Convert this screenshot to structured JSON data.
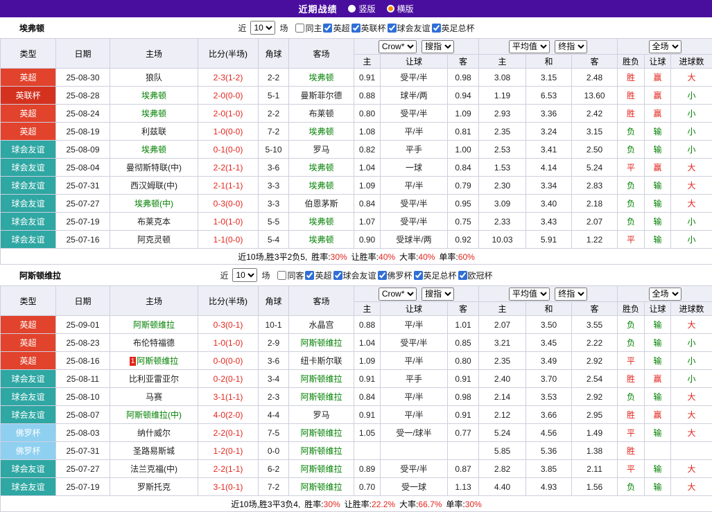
{
  "topbar": {
    "title": "近期战绩",
    "radios": [
      {
        "label": "竖版",
        "selected": false
      },
      {
        "label": "横版",
        "selected": true
      }
    ]
  },
  "colors": {
    "topbar_purple": "#4A0E9E",
    "epl_red": "#E2432C",
    "league_cup_red": "#D4321F",
    "friendly_teal": "#2FA7A3",
    "floro_blue": "#8FD0F0",
    "focus_team_green": "#008000",
    "win_red": "#E2241B",
    "loss_green": "#008000"
  },
  "sections": [
    {
      "team": "埃弗顿",
      "filter": {
        "near_label": "近",
        "games_value": "10",
        "games_label": "场",
        "checkboxes": [
          {
            "label": "同主",
            "checked": false
          },
          {
            "label": "英超",
            "checked": true
          },
          {
            "label": "英联杯",
            "checked": true
          },
          {
            "label": "球会友谊",
            "checked": true
          },
          {
            "label": "英足总杯",
            "checked": true
          }
        ]
      },
      "header": {
        "type": "类型",
        "date": "日期",
        "home": "主场",
        "score": "比分(半场)",
        "corner": "角球",
        "away": "客场",
        "odds_company": "Crow*",
        "odds_type": "搜指",
        "avg_label": "平均值",
        "final_label": "终指",
        "scope_label": "全场",
        "sub": [
          "主",
          "让球",
          "客",
          "主",
          "和",
          "客",
          "胜负",
          "让球",
          "进球数"
        ]
      },
      "rows": [
        {
          "type": "英超",
          "type_color": "red",
          "date": "25-08-30",
          "home": "狼队",
          "score": "2-3(1-2)",
          "corner": "2-2",
          "away": "埃弗顿",
          "away_focus": true,
          "o1": "0.91",
          "line": "受平/半",
          "o2": "0.98",
          "a1": "3.08",
          "a2": "3.15",
          "a3": "2.48",
          "res": "胜",
          "res_c": "red",
          "cover": "赢",
          "cover_c": "red",
          "goals": "大",
          "goals_c": "red"
        },
        {
          "type": "英联杯",
          "type_color": "darkred",
          "date": "25-08-28",
          "home": "埃弗顿",
          "home_focus": true,
          "score": "2-0(0-0)",
          "corner": "5-1",
          "away": "曼斯菲尔德",
          "o1": "0.88",
          "line": "球半/两",
          "o2": "0.94",
          "a1": "1.19",
          "a2": "6.53",
          "a3": "13.60",
          "res": "胜",
          "res_c": "red",
          "cover": "赢",
          "cover_c": "red",
          "goals": "小",
          "goals_c": "green"
        },
        {
          "type": "英超",
          "type_color": "red",
          "date": "25-08-24",
          "home": "埃弗顿",
          "home_focus": true,
          "score": "2-0(1-0)",
          "corner": "2-2",
          "away": "布莱顿",
          "o1": "0.80",
          "line": "受平/半",
          "o2": "1.09",
          "a1": "2.93",
          "a2": "3.36",
          "a3": "2.42",
          "res": "胜",
          "res_c": "red",
          "cover": "赢",
          "cover_c": "red",
          "goals": "小",
          "goals_c": "green"
        },
        {
          "type": "英超",
          "type_color": "red",
          "date": "25-08-19",
          "home": "利兹联",
          "score": "1-0(0-0)",
          "corner": "7-2",
          "away": "埃弗顿",
          "away_focus": true,
          "o1": "1.08",
          "line": "平/半",
          "o2": "0.81",
          "a1": "2.35",
          "a2": "3.24",
          "a3": "3.15",
          "res": "负",
          "res_c": "green",
          "cover": "输",
          "cover_c": "green",
          "goals": "小",
          "goals_c": "green"
        },
        {
          "type": "球会友谊",
          "type_color": "teal",
          "date": "25-08-09",
          "home": "埃弗顿",
          "home_focus": true,
          "score": "0-1(0-0)",
          "corner": "5-10",
          "away": "罗马",
          "o1": "0.82",
          "line": "平手",
          "o2": "1.00",
          "a1": "2.53",
          "a2": "3.41",
          "a3": "2.50",
          "res": "负",
          "res_c": "green",
          "cover": "输",
          "cover_c": "green",
          "goals": "小",
          "goals_c": "green"
        },
        {
          "type": "球会友谊",
          "type_color": "teal",
          "date": "25-08-04",
          "home": "曼彻斯特联(中)",
          "score": "2-2(1-1)",
          "corner": "3-6",
          "away": "埃弗顿",
          "away_focus": true,
          "o1": "1.04",
          "line": "一球",
          "o2": "0.84",
          "a1": "1.53",
          "a2": "4.14",
          "a3": "5.24",
          "res": "平",
          "res_c": "red",
          "cover": "赢",
          "cover_c": "red",
          "goals": "大",
          "goals_c": "red"
        },
        {
          "type": "球会友谊",
          "type_color": "teal",
          "date": "25-07-31",
          "home": "西汉姆联(中)",
          "score": "2-1(1-1)",
          "corner": "3-3",
          "away": "埃弗顿",
          "away_focus": true,
          "o1": "1.09",
          "line": "平/半",
          "o2": "0.79",
          "a1": "2.30",
          "a2": "3.34",
          "a3": "2.83",
          "res": "负",
          "res_c": "green",
          "cover": "输",
          "cover_c": "green",
          "goals": "大",
          "goals_c": "red"
        },
        {
          "type": "球会友谊",
          "type_color": "teal",
          "date": "25-07-27",
          "home": "埃弗顿(中)",
          "home_focus": true,
          "score": "0-3(0-0)",
          "corner": "3-3",
          "away": "伯恩茅斯",
          "o1": "0.84",
          "line": "受平/半",
          "o2": "0.95",
          "a1": "3.09",
          "a2": "3.40",
          "a3": "2.18",
          "res": "负",
          "res_c": "green",
          "cover": "输",
          "cover_c": "green",
          "goals": "大",
          "goals_c": "red"
        },
        {
          "type": "球会友谊",
          "type_color": "teal",
          "date": "25-07-19",
          "home": "布莱克本",
          "score": "1-0(1-0)",
          "corner": "5-5",
          "away": "埃弗顿",
          "away_focus": true,
          "o1": "1.07",
          "line": "受平/半",
          "o2": "0.75",
          "a1": "2.33",
          "a2": "3.43",
          "a3": "2.07",
          "res": "负",
          "res_c": "green",
          "cover": "输",
          "cover_c": "green",
          "goals": "小",
          "goals_c": "green"
        },
        {
          "type": "球会友谊",
          "type_color": "teal",
          "date": "25-07-16",
          "home": "阿克灵顿",
          "score": "1-1(0-0)",
          "corner": "5-4",
          "away": "埃弗顿",
          "away_focus": true,
          "o1": "0.90",
          "line": "受球半/两",
          "o2": "0.92",
          "a1": "10.03",
          "a2": "5.91",
          "a3": "1.22",
          "res": "平",
          "res_c": "red",
          "cover": "输",
          "cover_c": "green",
          "goals": "小",
          "goals_c": "green"
        }
      ],
      "summary": {
        "prefix": "近10场,胜3平2负5,",
        "stats": [
          {
            "label": "胜率:",
            "value": "30%"
          },
          {
            "label": "让胜率:",
            "value": "40%"
          },
          {
            "label": "大率:",
            "value": "40%"
          },
          {
            "label": "单率:",
            "value": "60%"
          }
        ]
      }
    },
    {
      "team": "阿斯顿维拉",
      "filter": {
        "near_label": "近",
        "games_value": "10",
        "games_label": "场",
        "checkboxes": [
          {
            "label": "同客",
            "checked": false
          },
          {
            "label": "英超",
            "checked": true
          },
          {
            "label": "球会友谊",
            "checked": true
          },
          {
            "label": "佛罗杯",
            "checked": true
          },
          {
            "label": "英足总杯",
            "checked": true
          },
          {
            "label": "欧冠杯",
            "checked": true
          }
        ]
      },
      "header": {
        "type": "类型",
        "date": "日期",
        "home": "主场",
        "score": "比分(半场)",
        "corner": "角球",
        "away": "客场",
        "odds_company": "Crow*",
        "odds_type": "搜指",
        "avg_label": "平均值",
        "final_label": "终指",
        "scope_label": "全场",
        "sub": [
          "主",
          "让球",
          "客",
          "主",
          "和",
          "客",
          "胜负",
          "让球",
          "进球数"
        ]
      },
      "rows": [
        {
          "type": "英超",
          "type_color": "red",
          "date": "25-09-01",
          "home": "阿斯顿维拉",
          "home_focus": true,
          "score": "0-3(0-1)",
          "corner": "10-1",
          "away": "水晶宫",
          "o1": "0.88",
          "line": "平/半",
          "o2": "1.01",
          "a1": "2.07",
          "a2": "3.50",
          "a3": "3.55",
          "res": "负",
          "res_c": "green",
          "cover": "输",
          "cover_c": "green",
          "goals": "大",
          "goals_c": "red"
        },
        {
          "type": "英超",
          "type_color": "red",
          "date": "25-08-23",
          "home": "布伦特福德",
          "score": "1-0(1-0)",
          "corner": "2-9",
          "away": "阿斯顿维拉",
          "away_focus": true,
          "o1": "1.04",
          "line": "受平/半",
          "o2": "0.85",
          "a1": "3.21",
          "a2": "3.45",
          "a3": "2.22",
          "res": "负",
          "res_c": "green",
          "cover": "输",
          "cover_c": "green",
          "goals": "小",
          "goals_c": "green"
        },
        {
          "type": "英超",
          "type_color": "red",
          "date": "25-08-16",
          "home": "阿斯顿维拉",
          "home_focus": true,
          "home_badge": "1",
          "score": "0-0(0-0)",
          "corner": "3-6",
          "away": "纽卡斯尔联",
          "o1": "1.09",
          "line": "平/半",
          "o2": "0.80",
          "a1": "2.35",
          "a2": "3.49",
          "a3": "2.92",
          "res": "平",
          "res_c": "red",
          "cover": "输",
          "cover_c": "green",
          "goals": "小",
          "goals_c": "green"
        },
        {
          "type": "球会友谊",
          "type_color": "teal",
          "date": "25-08-11",
          "home": "比利亚雷亚尔",
          "score": "0-2(0-1)",
          "corner": "3-4",
          "away": "阿斯顿维拉",
          "away_focus": true,
          "o1": "0.91",
          "line": "平手",
          "o2": "0.91",
          "a1": "2.40",
          "a2": "3.70",
          "a3": "2.54",
          "res": "胜",
          "res_c": "red",
          "cover": "赢",
          "cover_c": "red",
          "goals": "小",
          "goals_c": "green"
        },
        {
          "type": "球会友谊",
          "type_color": "teal",
          "date": "25-08-10",
          "home": "马赛",
          "score": "3-1(1-1)",
          "corner": "2-3",
          "away": "阿斯顿维拉",
          "away_focus": true,
          "o1": "0.84",
          "line": "平/半",
          "o2": "0.98",
          "a1": "2.14",
          "a2": "3.53",
          "a3": "2.92",
          "res": "负",
          "res_c": "green",
          "cover": "输",
          "cover_c": "green",
          "goals": "大",
          "goals_c": "red"
        },
        {
          "type": "球会友谊",
          "type_color": "teal",
          "date": "25-08-07",
          "home": "阿斯顿维拉(中)",
          "home_focus": true,
          "score": "4-0(2-0)",
          "corner": "4-4",
          "away": "罗马",
          "o1": "0.91",
          "line": "平/半",
          "o2": "0.91",
          "a1": "2.12",
          "a2": "3.66",
          "a3": "2.95",
          "res": "胜",
          "res_c": "red",
          "cover": "赢",
          "cover_c": "red",
          "goals": "大",
          "goals_c": "red"
        },
        {
          "type": "佛罗杯",
          "type_color": "skyblue",
          "date": "25-08-03",
          "home": "纳什威尔",
          "score": "2-2(0-1)",
          "corner": "7-5",
          "away": "阿斯顿维拉",
          "away_focus": true,
          "o1": "1.05",
          "line": "受一/球半",
          "o2": "0.77",
          "a1": "5.24",
          "a2": "4.56",
          "a3": "1.49",
          "res": "平",
          "res_c": "red",
          "cover": "输",
          "cover_c": "green",
          "goals": "大",
          "goals_c": "red"
        },
        {
          "type": "佛罗杯",
          "type_color": "skyblue",
          "date": "25-07-31",
          "home": "圣路易斯城",
          "score": "1-2(0-1)",
          "corner": "0-0",
          "away": "阿斯顿维拉",
          "away_focus": true,
          "o1": "",
          "line": "",
          "o2": "",
          "a1": "5.85",
          "a2": "5.36",
          "a3": "1.38",
          "res": "胜",
          "res_c": "red",
          "cover": "",
          "goals": ""
        },
        {
          "type": "球会友谊",
          "type_color": "teal",
          "date": "25-07-27",
          "home": "法兰克福(中)",
          "score": "2-2(1-1)",
          "corner": "6-2",
          "away": "阿斯顿维拉",
          "away_focus": true,
          "o1": "0.89",
          "line": "受平/半",
          "o2": "0.87",
          "a1": "2.82",
          "a2": "3.85",
          "a3": "2.11",
          "res": "平",
          "res_c": "red",
          "cover": "输",
          "cover_c": "green",
          "goals": "大",
          "goals_c": "red"
        },
        {
          "type": "球会友谊",
          "type_color": "teal",
          "date": "25-07-19",
          "home": "罗斯托克",
          "score": "3-1(0-1)",
          "corner": "7-2",
          "away": "阿斯顿维拉",
          "away_focus": true,
          "o1": "0.70",
          "line": "受一球",
          "o2": "1.13",
          "a1": "4.40",
          "a2": "4.93",
          "a3": "1.56",
          "res": "负",
          "res_c": "green",
          "cover": "输",
          "cover_c": "green",
          "goals": "大",
          "goals_c": "red"
        }
      ],
      "summary": {
        "prefix": "近10场,胜3平3负4,",
        "stats": [
          {
            "label": "胜率:",
            "value": "30%"
          },
          {
            "label": "让胜率:",
            "value": "22.2%"
          },
          {
            "label": "大率:",
            "value": "66.7%"
          },
          {
            "label": "单率:",
            "value": "30%"
          }
        ]
      }
    }
  ]
}
